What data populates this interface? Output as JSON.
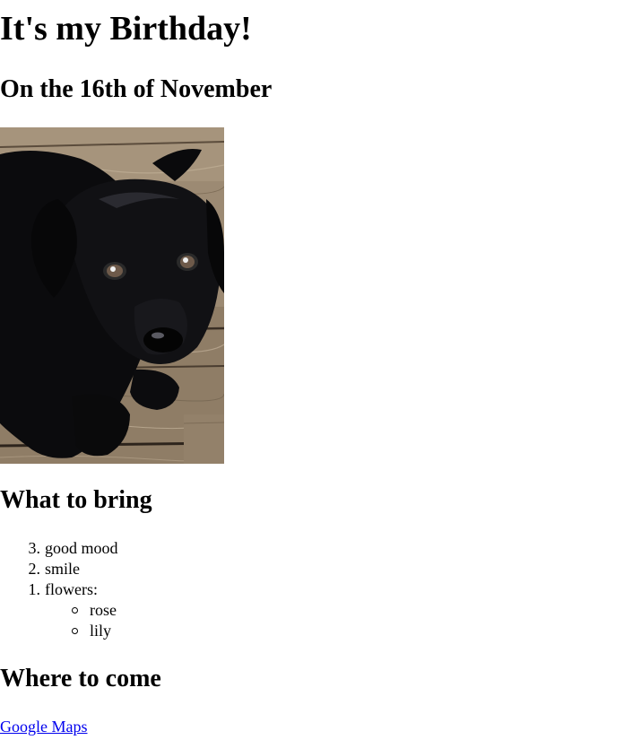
{
  "page": {
    "title": "It's my Birthday!",
    "date_heading": "On the 16th of November"
  },
  "photo": {
    "alt": "black puppy"
  },
  "bring": {
    "heading": "What to bring",
    "items": [
      {
        "number": "3.",
        "label": "good mood"
      },
      {
        "number": "2.",
        "label": "smile"
      },
      {
        "number": "1.",
        "label": "flowers:"
      }
    ],
    "flowers": [
      {
        "label": "rose"
      },
      {
        "label": "lily"
      }
    ]
  },
  "where": {
    "heading": "Where to come",
    "link_label": "Google Maps"
  }
}
